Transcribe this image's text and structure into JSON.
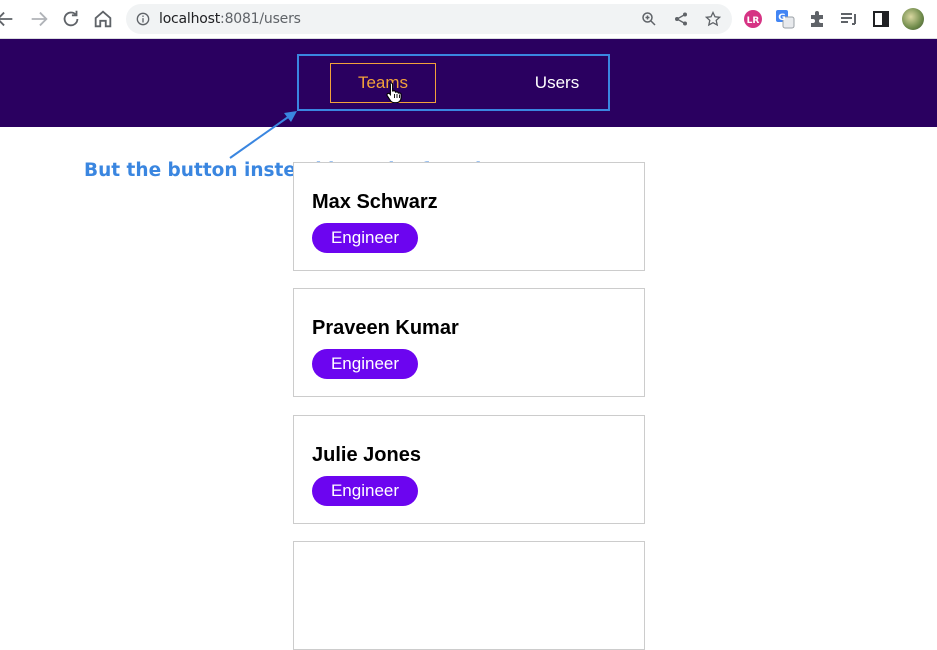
{
  "browser": {
    "url_host": "localhost",
    "url_rest": ":8081/users",
    "icons": {
      "back": "arrow-left-icon",
      "forward": "arrow-right-icon",
      "reload": "reload-icon",
      "home": "home-icon",
      "info": "info-icon",
      "zoom": "zoom-icon",
      "share": "share-icon",
      "bookmark": "star-icon"
    },
    "extensions": [
      "lr-extension-icon",
      "translate-extension-icon",
      "puzzle-extensions-icon",
      "reading-list-icon",
      "side-panel-icon"
    ]
  },
  "header": {
    "background": "#2a0060",
    "nav": [
      {
        "label": "Teams",
        "state": "hovered"
      },
      {
        "label": "Users",
        "state": "active"
      }
    ]
  },
  "annotation": {
    "text": "But the button instead loses its function...",
    "color": "#3a86e0"
  },
  "users": [
    {
      "name": "Max Schwarz",
      "role": "Engineer"
    },
    {
      "name": "Praveen Kumar",
      "role": "Engineer"
    },
    {
      "name": "Julie Jones",
      "role": "Engineer"
    },
    {
      "name": "",
      "role": ""
    }
  ],
  "colors": {
    "badge": "#6c05f0",
    "teams_hover": "#f2a23a"
  }
}
